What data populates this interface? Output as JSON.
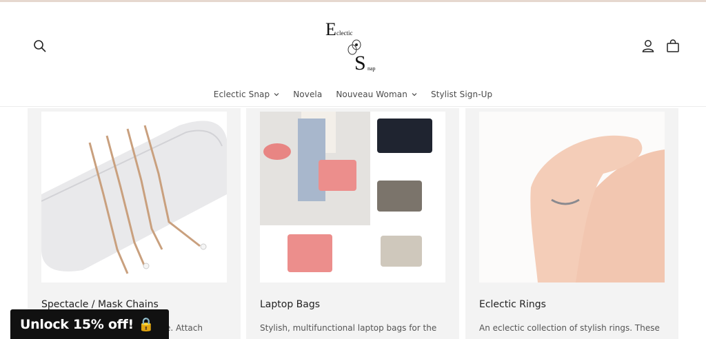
{
  "header": {
    "logo_letter_top": "E",
    "logo_word_top": "clectic",
    "logo_letter_bottom": "S",
    "logo_word_bottom": "nap",
    "icons": [
      "search-icon",
      "account-icon",
      "cart-icon"
    ]
  },
  "nav": {
    "items": [
      {
        "label": "Eclectic Snap",
        "has_dropdown": true
      },
      {
        "label": "Novela",
        "has_dropdown": false
      },
      {
        "label": "Nouveau Woman",
        "has_dropdown": true
      },
      {
        "label": "Stylist Sign-Up",
        "has_dropdown": false
      }
    ]
  },
  "cards": [
    {
      "title": "Spectacle / Mask Chains",
      "description": "e. Attach"
    },
    {
      "title": "Laptop Bags",
      "description": "Stylish, multifunctional laptop bags for the"
    },
    {
      "title": "Eclectic Rings",
      "description": "An eclectic collection of stylish rings. These"
    }
  ],
  "promo": {
    "label": "Unlock 15% off! 🔒"
  },
  "colors": {
    "topbar": "#e6d8cf",
    "card_bg": "#f3f3f3",
    "promo_bg": "#111111"
  }
}
